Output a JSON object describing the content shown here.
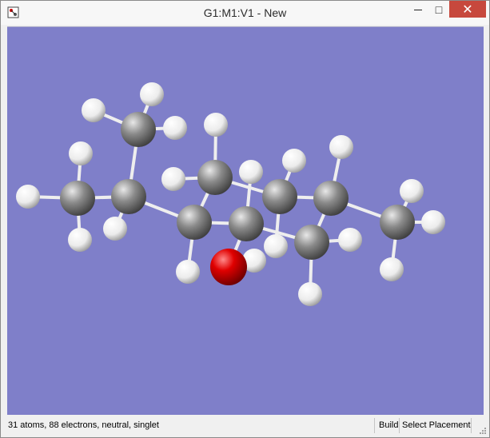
{
  "window": {
    "title": "G1:M1:V1 - New",
    "minimize_glyph": "—",
    "maximize_glyph": "□",
    "close_glyph": "✕"
  },
  "colors": {
    "viewport_background": "#7f7fc9",
    "close_button": "#c7483d",
    "carbon": "#7a7a7a",
    "hydrogen": "#f2f2f2",
    "oxygen": "#e00000",
    "bond": "#eeeeee"
  },
  "molecule": {
    "atom_counts": {
      "carbon": 10,
      "oxygen": 1,
      "hydrogen": 20
    },
    "render_style": "ball-and-stick"
  },
  "statusbar": {
    "info": "31 atoms, 88 electrons, neutral, singlet",
    "mode": "Build",
    "placement": "Select Placement"
  },
  "icons": {
    "app": "gaussview-window-icon",
    "resize": "resize-grip-icon"
  }
}
